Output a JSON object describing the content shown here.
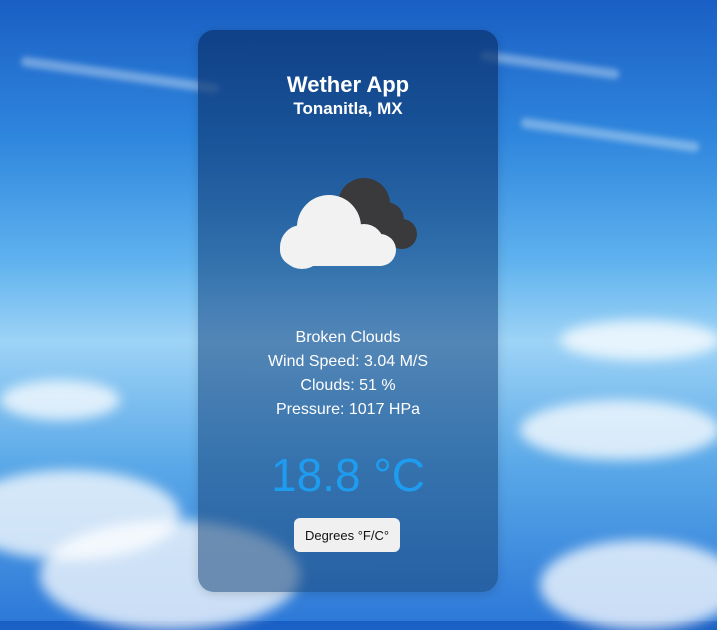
{
  "app": {
    "title": "Wether App",
    "location": "Tonanitla, MX"
  },
  "weather": {
    "icon": "broken-clouds-icon",
    "description": "Broken Clouds",
    "wind_speed": "Wind Speed: 3.04 M/S",
    "clouds": "Clouds: 51 %",
    "pressure": "Pressure: 1017 HPa",
    "temperature": "18.8 °C"
  },
  "controls": {
    "unit_toggle_label": "Degrees °F/C°"
  },
  "colors": {
    "temperature": "#1e9cf0",
    "card": "#0f3f7a",
    "button": "#f0f0f0"
  }
}
